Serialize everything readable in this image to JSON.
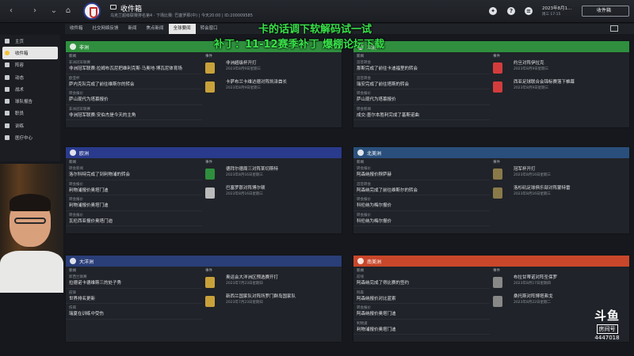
{
  "header": {
    "title": "收件箱",
    "subtitle": "乌克兰超级联赛排名第4 · 下场比赛: 巴塞罗那(中) | 今天20:00 | ID:200009585",
    "date": "2023年8月1...",
    "date_sub": "周三 17:15",
    "continue_label": "收件箱"
  },
  "tabs": [
    "收件箱",
    "社交网络反馈",
    "新闻",
    "焦点新闻",
    "全球要闻",
    "转会窗口"
  ],
  "active_tab": "全球要闻",
  "overlay": {
    "line1": "卡的话调下软解码试一试",
    "line2": "补丁：11-12赛季补丁 爆棚论坛下载"
  },
  "sidebar": [
    {
      "label": "主页"
    },
    {
      "label": "收件箱"
    },
    {
      "label": "阵容"
    },
    {
      "label": "动态"
    },
    {
      "label": "战术"
    },
    {
      "label": "球队报告"
    },
    {
      "label": "职员"
    },
    {
      "label": "训练"
    },
    {
      "label": "医疗中心"
    }
  ],
  "labels": {
    "news": "新闻",
    "events": "事件"
  },
  "cards": [
    {
      "name": "非洲",
      "color": "#2f8f3e",
      "news": [
        {
          "cat": "非洲冠军联赛",
          "text": "非洲冠军联赛:拉姆布瓦尼把维利克斯·马奥地·博瓦尼体育场"
        },
        {
          "cat": "欧亚杯",
          "text": "萨内克队完成了前往维斯尔的转会"
        },
        {
          "cat": "转会报价",
          "text": "萨山现代为塔慕报价"
        },
        {
          "cat": "非洲冠军联赛",
          "text": "非洲冠军联赛:安伯杰是今天的主角"
        }
      ],
      "events": [
        {
          "text": "非洲超级杯开打",
          "date": "2023年8月9日星期三",
          "color": "#c8a13a"
        },
        {
          "text": "卡萨布兰卡维达德对阵凯泽酋长",
          "date": "2023年8月9日星期三",
          "color": "#c8a13a"
        }
      ]
    },
    {
      "name": "亚洲",
      "color": "#2f8f3e",
      "news": [
        {
          "cat": "首签转会",
          "text": "那斯完成了前往卡迪福里的转会"
        },
        {
          "cat": "首签转会",
          "text": "瑞安完成了前往塔斯的转会"
        },
        {
          "cat": "转会报价",
          "text": "萨山现代为塔慕报价"
        },
        {
          "cat": "转会新闻",
          "text": "成交:墨尔本胜利完成了基斯诺曲"
        }
      ],
      "events": [
        {
          "text": "约旦对阵伊拉克",
          "date": "2023年8月9日星期三",
          "color": "#d33c3c"
        },
        {
          "text": "西亚足球联合会锦标赛落下帷幕",
          "date": "2023年8月9日星期三",
          "color": "#d33c3c"
        }
      ]
    },
    {
      "name": "欧洲",
      "color": "#2a3a8c",
      "news": [
        {
          "cat": "转会新闻",
          "text": "洛尔科特完成了到利物浦的转会"
        },
        {
          "cat": "转会报价",
          "text": "利物浦报价奥塔门迪"
        },
        {
          "cat": "转会报价",
          "text": "利物浦报价奥塔门迪"
        },
        {
          "cat": "转会报价",
          "text": "瓦伦西亚报价奥塔门迪"
        }
      ],
      "events": [
        {
          "text": "德拜尔德周三对阵某切斯特",
          "date": "2023年8月16日星期三",
          "color": "#2f8f3e"
        },
        {
          "text": "巴塞罗那对阵博尔顿",
          "date": "2023年8月16日星期三",
          "color": "#bbbbbb"
        }
      ]
    },
    {
      "name": "北美洲",
      "color": "#2a4f7c",
      "news": [
        {
          "cat": "转会报价",
          "text": "阿森纳报价穆萨赫"
        },
        {
          "cat": "首签转会",
          "text": "阿森纳完成了前往维斯尔的转会"
        },
        {
          "cat": "转会报价",
          "text": "科伦纳为梅尔报价"
        },
        {
          "cat": "转会报价",
          "text": "科伦纳为梅尔报价"
        }
      ],
      "events": [
        {
          "text": "冠军杯开打",
          "date": "2023年8月16日星期三",
          "color": "#8a7a4a"
        },
        {
          "text": "洛杉矶足球俱乐部对阵蒙特雷",
          "date": "2023年8月16日星期三",
          "color": "#8a7a4a"
        }
      ]
    },
    {
      "name": "大洋洲",
      "color": "#2a3e78",
      "news": [
        {
          "cat": "新西兰联赛",
          "text": "拉德诺卡德维斯三的处子秀"
        },
        {
          "cat": "前锋",
          "text": "世界排名更新"
        },
        {
          "cat": "伤病",
          "text": "瑞夏在训练中受伤"
        }
      ],
      "events": [
        {
          "text": "奥运会大洋洲区预选赛开打",
          "date": "2023年7月23日星期日",
          "color": "#c8a13a"
        },
        {
          "text": "新西兰国家队对阵所罗门群岛国家队",
          "date": "2023年7月23日星期日",
          "color": "#c8a13a"
        }
      ]
    },
    {
      "name": "南美洲",
      "color": "#c8472a",
      "news": [
        {
          "cat": "前线",
          "text": "阿森纳完成了得比赛的签约"
        },
        {
          "cat": "阿森",
          "text": "阿森纳报价对比蓝索"
        },
        {
          "cat": "转会报价",
          "text": "阿森纳报价奥塔门迪"
        },
        {
          "cat": "利物浦",
          "text": "利物浦报价奥塔门迪"
        }
      ],
      "events": [
        {
          "text": "布拉甘蒂诺对阵圣保罗",
          "date": "2023年8月17日星期四",
          "color": "#888888"
        },
        {
          "text": "桑托斯对阵博塔弗戈",
          "date": "2023年8月22日星期二",
          "color": "#888888"
        }
      ]
    }
  ],
  "watermark": {
    "logo": "斗鱼",
    "sub": "房间号",
    "room": "4447018"
  }
}
